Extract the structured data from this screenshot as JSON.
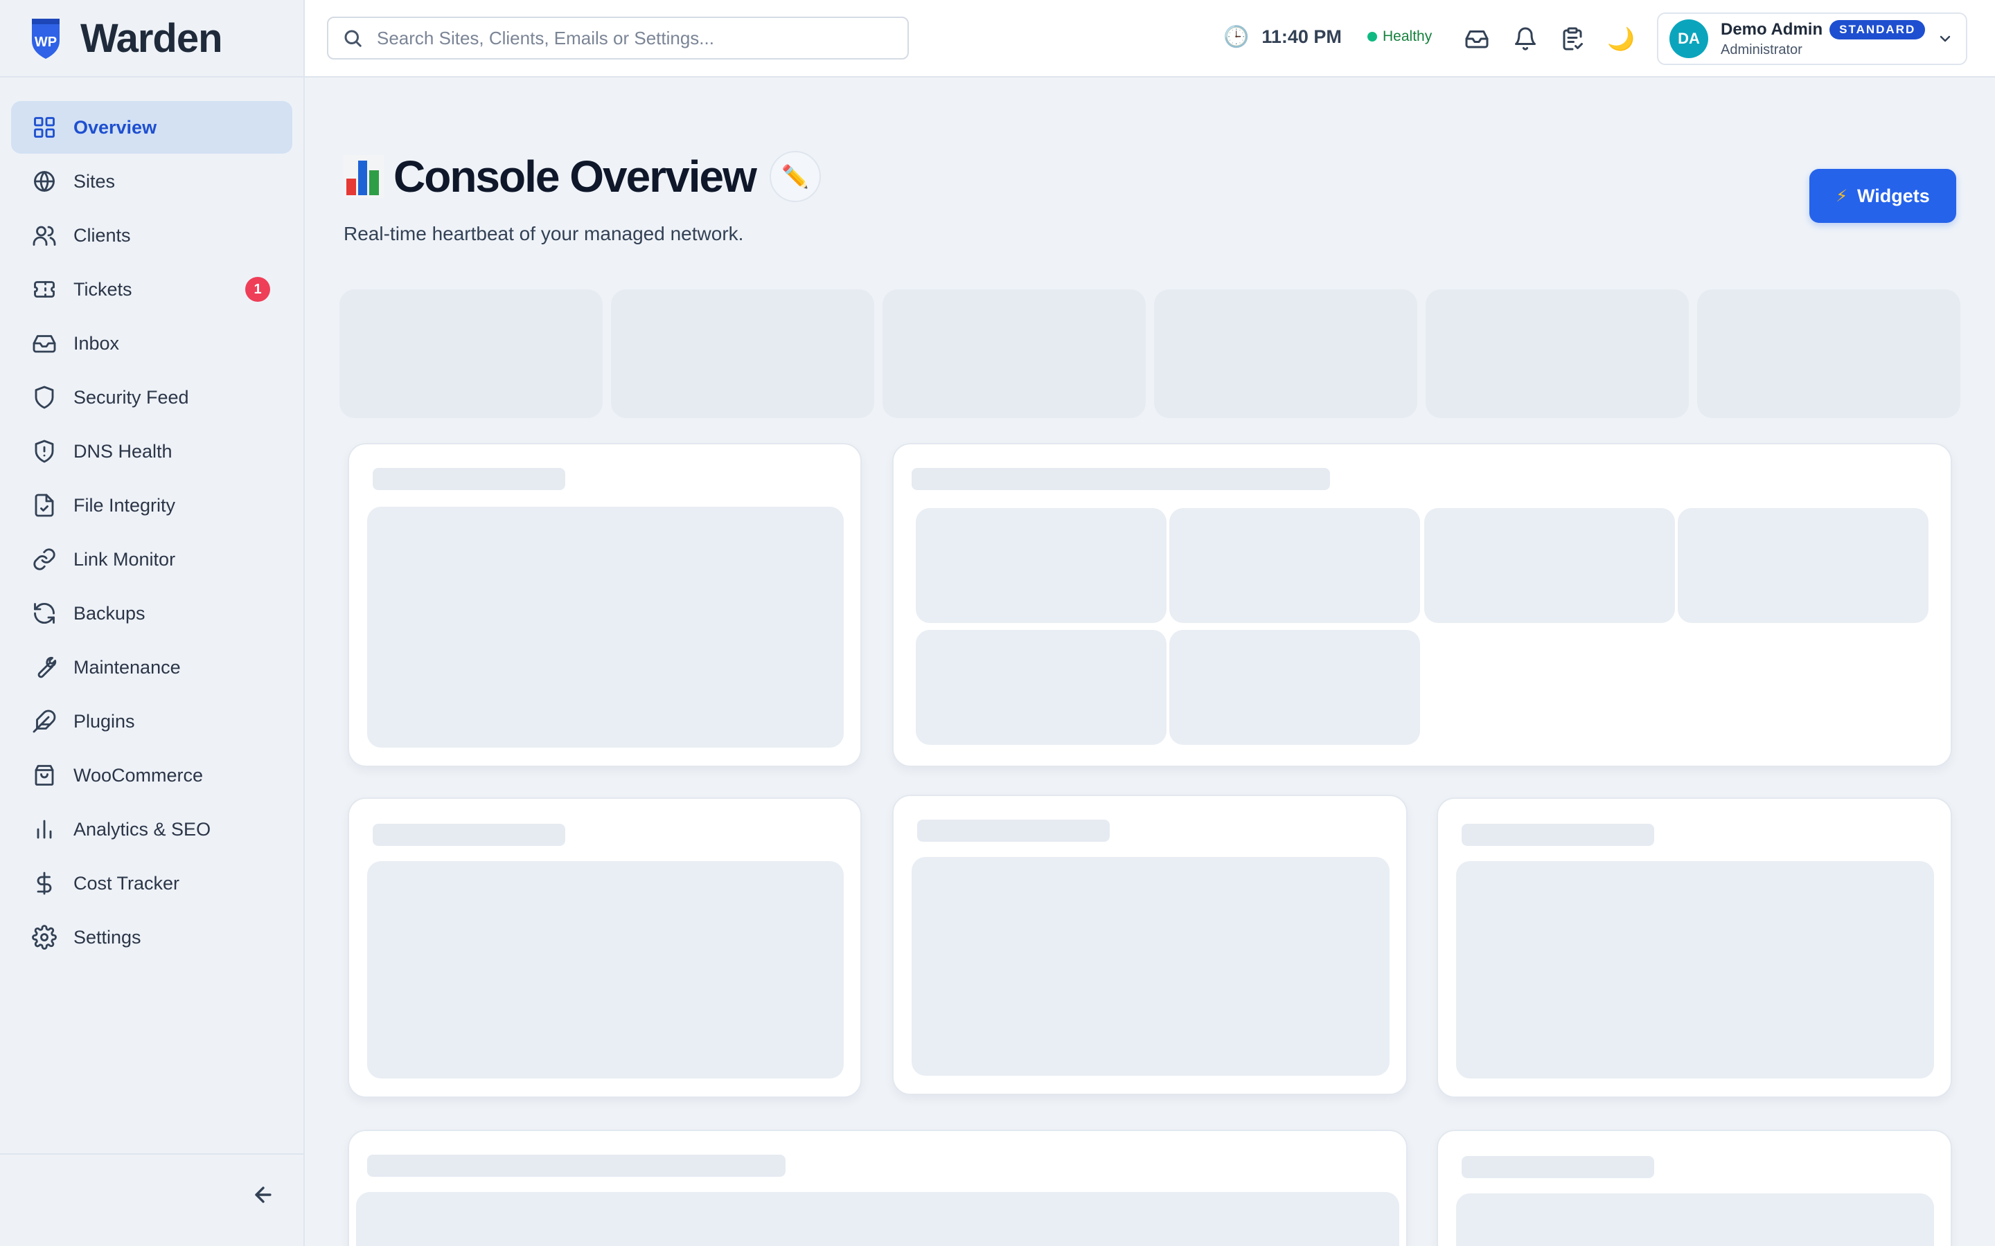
{
  "brand": {
    "name": "Warden",
    "logo_text": "WP",
    "logo_color": "#2563eb"
  },
  "sidebar": {
    "items": [
      {
        "label": "Overview",
        "icon": "grid-icon",
        "active": true
      },
      {
        "label": "Sites",
        "icon": "globe-icon"
      },
      {
        "label": "Clients",
        "icon": "users-icon"
      },
      {
        "label": "Tickets",
        "icon": "ticket-icon",
        "badge": "1"
      },
      {
        "label": "Inbox",
        "icon": "inbox-icon"
      },
      {
        "label": "Security Feed",
        "icon": "shield-icon"
      },
      {
        "label": "DNS Health",
        "icon": "shield-alert-icon"
      },
      {
        "label": "File Integrity",
        "icon": "file-check-icon"
      },
      {
        "label": "Link Monitor",
        "icon": "link-icon"
      },
      {
        "label": "Backups",
        "icon": "refresh-icon"
      },
      {
        "label": "Maintenance",
        "icon": "wrench-icon"
      },
      {
        "label": "Plugins",
        "icon": "feather-icon"
      },
      {
        "label": "WooCommerce",
        "icon": "shopping-bag-icon"
      },
      {
        "label": "Analytics & SEO",
        "icon": "bar-chart-icon"
      },
      {
        "label": "Cost Tracker",
        "icon": "dollar-icon"
      },
      {
        "label": "Settings",
        "icon": "gear-icon"
      }
    ],
    "collapse_icon": "arrow-left-icon"
  },
  "topbar": {
    "search_placeholder": "Search Sites, Clients, Emails or Settings...",
    "clock_icon": "🕒",
    "time": "11:40 PM",
    "health_status": "Healthy",
    "health_color": "#10b981",
    "icons": [
      "inbox-icon",
      "bell-icon",
      "clipboard-icon",
      "moon-icon"
    ],
    "moon_glyph": "🌙",
    "user": {
      "initials": "DA",
      "name": "Demo Admin",
      "plan": "STANDARD",
      "role": "Administrator",
      "avatar_color": "#0aa5bd"
    }
  },
  "main": {
    "title_emoji": "📊",
    "title": "Console Overview",
    "edit_glyph": "✏️",
    "subtitle": "Real-time heartbeat of your managed network.",
    "widgets_bolt": "⚡",
    "widgets_label": "Widgets",
    "accent": "#2563eb"
  }
}
